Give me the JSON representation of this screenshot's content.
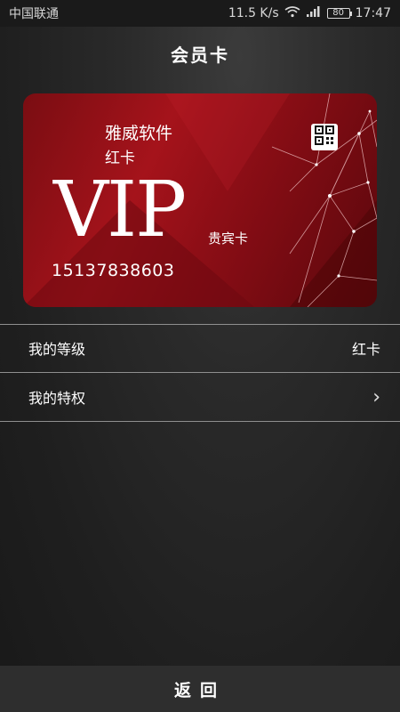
{
  "status_bar": {
    "carrier": "中国联通",
    "network_speed": "11.5 K/s",
    "battery": "80",
    "time": "17:47"
  },
  "header": {
    "title": "会员卡"
  },
  "card": {
    "company": "雅威软件",
    "level": "红卡",
    "vip_text": "VIP",
    "guest_text": "贵宾卡",
    "phone": "15137838603",
    "accent_color": "#a5131b"
  },
  "rows": [
    {
      "label": "我的等级",
      "value": "红卡"
    },
    {
      "label": "我的特权",
      "value": "›"
    }
  ],
  "footer": {
    "back_label": "返回"
  }
}
